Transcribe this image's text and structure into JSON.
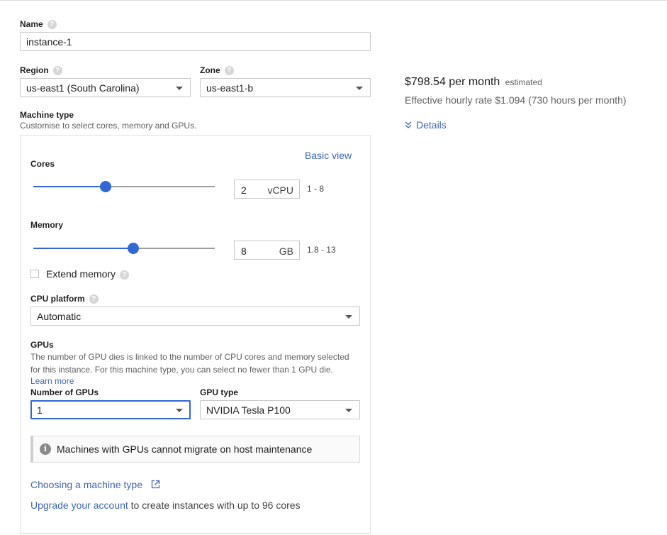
{
  "name": {
    "label": "Name",
    "value": "instance-1"
  },
  "region": {
    "label": "Region",
    "value": "us-east1 (South Carolina)"
  },
  "zone": {
    "label": "Zone",
    "value": "us-east1-b"
  },
  "machine_type": {
    "label": "Machine type",
    "subtitle": "Customise to select cores, memory and GPUs.",
    "basic_view_link": "Basic view",
    "cores": {
      "label": "Cores",
      "value": "2",
      "unit": "vCPU",
      "range": "1 - 8",
      "slider_fraction": 0.4
    },
    "memory": {
      "label": "Memory",
      "value": "8",
      "unit": "GB",
      "range": "1.8 - 13",
      "slider_fraction": 0.55
    },
    "extend_memory": {
      "label": "Extend memory",
      "checked": false
    },
    "cpu_platform": {
      "label": "CPU platform",
      "value": "Automatic"
    },
    "gpus": {
      "heading": "GPUs",
      "description_line1": "The number of GPU dies is linked to the number of CPU cores and memory selected",
      "description_line2": "for this instance. For this machine type, you can select no fewer than 1 GPU die.",
      "learn_more": "Learn more",
      "number_label": "Number of GPUs",
      "number_value": "1",
      "type_label": "GPU type",
      "type_value": "NVIDIA Tesla P100"
    },
    "info_message": "Machines with GPUs cannot migrate on host maintenance",
    "choosing_link": "Choosing a machine type",
    "upgrade_link": "Upgrade your account",
    "upgrade_suffix": " to create instances with up to 96 cores"
  },
  "pricing": {
    "price": "$798.54 per month",
    "estimated": "estimated",
    "hourly": "Effective hourly rate $1.094 (730 hours per month)",
    "details_link": "Details"
  },
  "icons": {
    "help": "?",
    "info": "i",
    "details_chevron": "double-chevron-down",
    "external": "external-link"
  },
  "colors": {
    "accent": "#3367d6",
    "link": "#3f67b5",
    "focus_border": "#3367d6"
  }
}
